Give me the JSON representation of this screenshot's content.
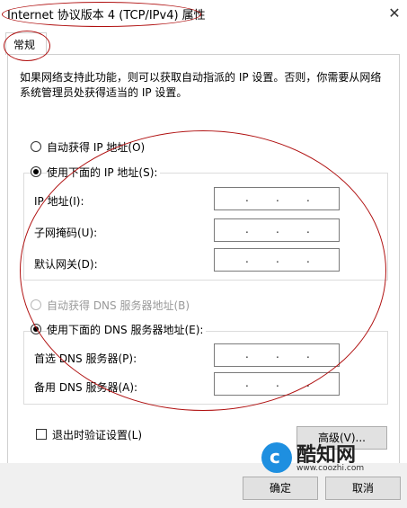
{
  "window": {
    "title": "Internet 协议版本 4 (TCP/IPv4) 属性"
  },
  "tabs": [
    {
      "label": "常规",
      "selected": true
    }
  ],
  "description": "如果网络支持此功能，则可以获取自动指派的 IP 设置。否则，你需要从网络系统管理员处获得适当的 IP 设置。",
  "ip_options": {
    "auto": {
      "label": "自动获得 IP 地址(O)",
      "selected": false
    },
    "manual": {
      "label": "使用下面的 IP 地址(S):",
      "selected": true
    }
  },
  "ip_fields": [
    {
      "label": "IP 地址(I):",
      "value": ""
    },
    {
      "label": "子网掩码(U):",
      "value": ""
    },
    {
      "label": "默认网关(D):",
      "value": ""
    }
  ],
  "dns_options": {
    "auto": {
      "label": "自动获得 DNS 服务器地址(B)",
      "selected": false,
      "disabled": true
    },
    "manual": {
      "label": "使用下面的 DNS 服务器地址(E):",
      "selected": true
    }
  },
  "dns_fields": [
    {
      "label": "首选 DNS 服务器(P):",
      "value": ""
    },
    {
      "label": "备用 DNS 服务器(A):",
      "value": ""
    }
  ],
  "validate_on_exit": {
    "label": "退出时验证设置(L)",
    "checked": false
  },
  "buttons": {
    "advanced": "高级(V)...",
    "ok": "确定",
    "cancel": "取消"
  },
  "watermark": {
    "brand": "酷知网",
    "url": "www.coozhi.com"
  },
  "colors": {
    "annotation": "#b01010",
    "logo": "#1e8fe0"
  }
}
